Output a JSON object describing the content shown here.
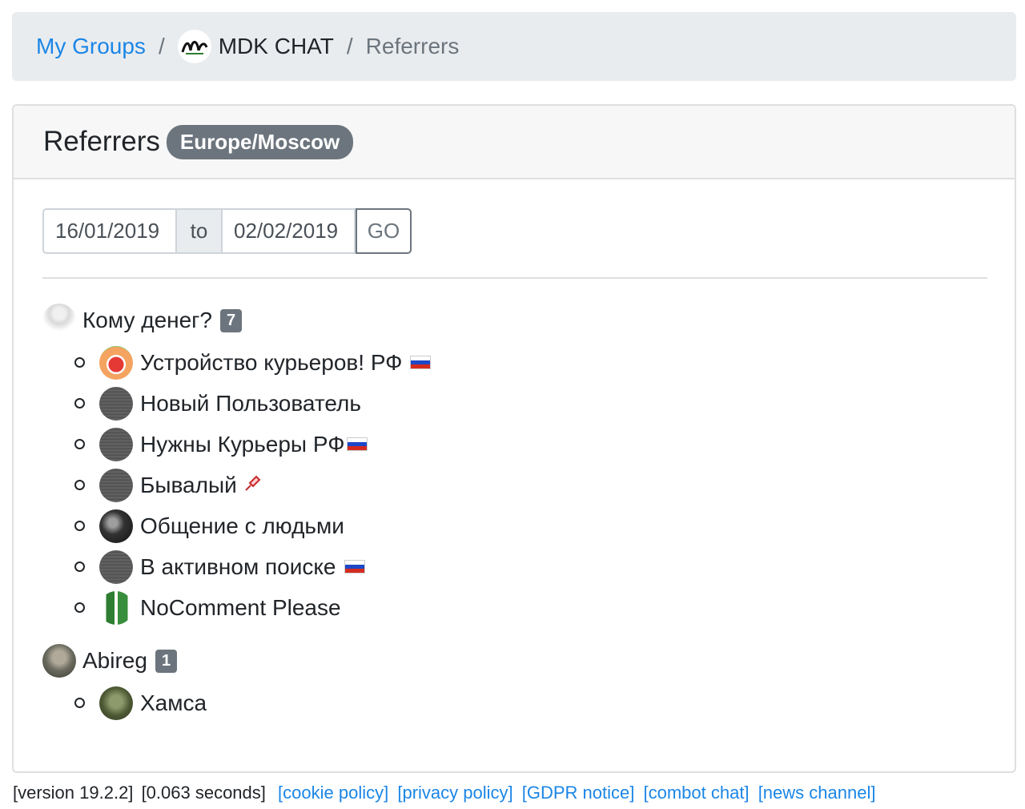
{
  "breadcrumb": {
    "my_groups": "My Groups",
    "separator": "/",
    "group_name": "MDK CHAT",
    "current": "Referrers"
  },
  "card": {
    "title": "Referrers",
    "timezone": "Europe/Moscow"
  },
  "filter": {
    "date_from": "16/01/2019",
    "to_label": "to",
    "date_to": "02/02/2019",
    "go_label": "GO"
  },
  "referrers": [
    {
      "name": "Кому денег?",
      "count": "7",
      "invited": [
        {
          "name": "Устройство курьеров! РФ",
          "flag": true
        },
        {
          "name": "Новый Пользователь"
        },
        {
          "name": "Нужны Курьеры РФ",
          "flag": true
        },
        {
          "name": "Бывалый",
          "emoji": "syringe"
        },
        {
          "name": "Общение с людьми"
        },
        {
          "name": "В активном поиске",
          "flag": true
        },
        {
          "name": "NoComment Please"
        }
      ]
    },
    {
      "name": "Abireg",
      "count": "1",
      "invited": [
        {
          "name": "Хамса"
        }
      ]
    }
  ],
  "footer": {
    "version": "[version 19.2.2]",
    "timing": "[0.063 seconds]",
    "links": [
      "[cookie policy]",
      "[privacy policy]",
      "[GDPR notice]",
      "[combot chat]",
      "[news channel]"
    ]
  },
  "colors": {
    "link": "#1b86e6",
    "badge": "#6c757d",
    "breadcrumb_bg": "#e9ecef"
  }
}
